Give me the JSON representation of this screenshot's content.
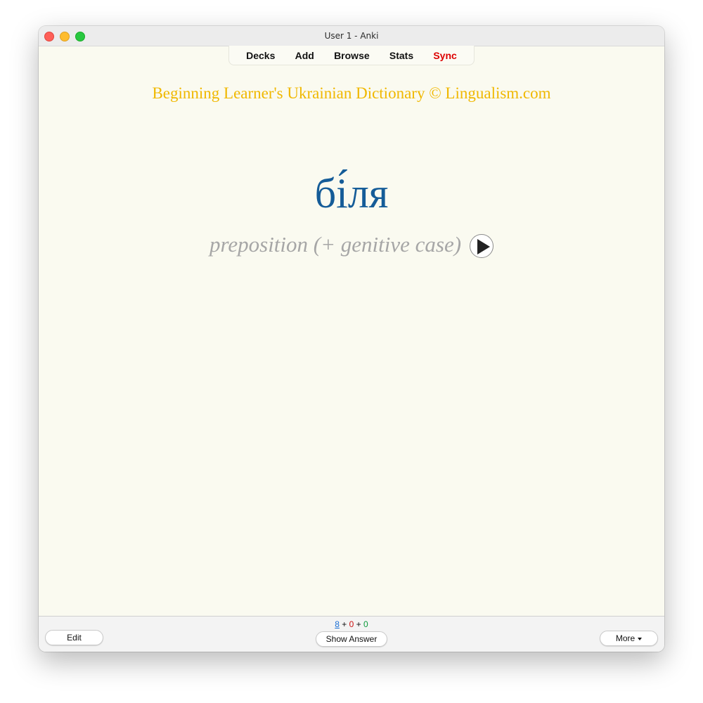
{
  "window": {
    "title": "User 1 - Anki"
  },
  "toolbar": {
    "decks": "Decks",
    "add": "Add",
    "browse": "Browse",
    "stats": "Stats",
    "sync": "Sync"
  },
  "card": {
    "dictionary_title": "Beginning Learner's Ukrainian Dictionary © Lingualism.com",
    "word": "бі́ля",
    "part_of_speech": "preposition (+ genitive case)",
    "audio_icon": "play-icon"
  },
  "bottom": {
    "edit_label": "Edit",
    "show_answer_label": "Show Answer",
    "more_label": "More",
    "counts": {
      "new": "8",
      "sep1": " + ",
      "learning": "0",
      "sep2": " + ",
      "review": "0"
    }
  },
  "colors": {
    "dictionary_title": "#f0b800",
    "word": "#155c98",
    "part_of_speech": "#a6a6a6",
    "sync": "#dd0000",
    "count_new": "#1a6fd6",
    "count_learning": "#cc1010",
    "count_review": "#0a9a3a"
  }
}
